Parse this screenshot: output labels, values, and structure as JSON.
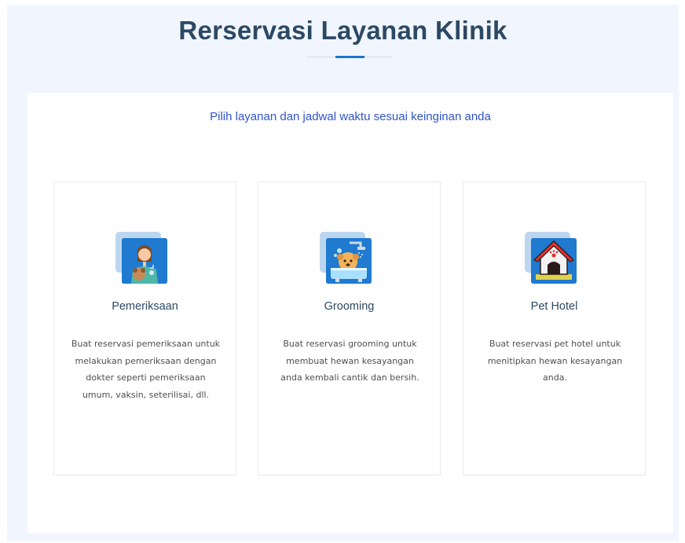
{
  "section": {
    "title": "Rerservasi Layanan Klinik",
    "subtitle": "Pilih layanan dan jadwal waktu sesuai keinginan anda"
  },
  "colors": {
    "heading": "#2c4964",
    "accent": "#1977cc",
    "subtitle": "#3054c7",
    "section_bg": "#f1f6fe"
  },
  "services": [
    {
      "icon": "doctor-pet-icon",
      "title": "Pemeriksaan",
      "description": "Buat reservasi pemeriksaan untuk melakukan pemeriksaan dengan dokter seperti pemeriksaan umum, vaksin, seterilisai, dll."
    },
    {
      "icon": "pet-bath-icon",
      "title": "Grooming",
      "description": "Buat reservasi grooming untuk membuat hewan kesayangan anda kembali cantik dan bersih."
    },
    {
      "icon": "pet-house-icon",
      "title": "Pet Hotel",
      "description": "Buat reservasi pet hotel untuk menitipkan hewan kesayangan anda."
    }
  ]
}
